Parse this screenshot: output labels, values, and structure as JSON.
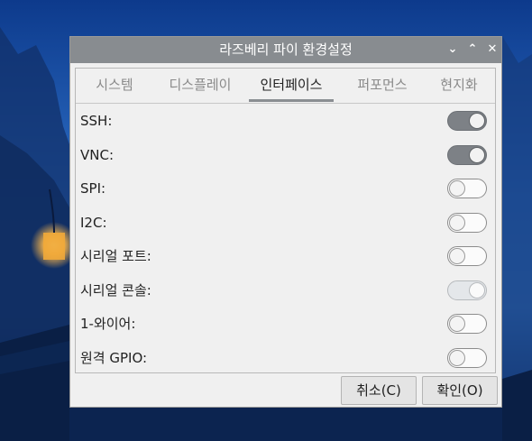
{
  "window": {
    "title": "라즈베리 파이 환경설정",
    "controls": {
      "minimize": "⌄",
      "maximize": "⌃",
      "close": "✕"
    }
  },
  "tabs": [
    {
      "label": "시스템",
      "active": false
    },
    {
      "label": "디스플레이",
      "active": false
    },
    {
      "label": "인터페이스",
      "active": true
    },
    {
      "label": "퍼포먼스",
      "active": false
    },
    {
      "label": "현지화",
      "active": false
    }
  ],
  "interfaces": [
    {
      "label": "SSH:",
      "state": "on"
    },
    {
      "label": "VNC:",
      "state": "on"
    },
    {
      "label": "SPI:",
      "state": "off"
    },
    {
      "label": "I2C:",
      "state": "off"
    },
    {
      "label": "시리얼 포트:",
      "state": "off"
    },
    {
      "label": "시리얼 콘솔:",
      "state": "disabled-on"
    },
    {
      "label": "1-와이어:",
      "state": "off"
    },
    {
      "label": "원격 GPIO:",
      "state": "off"
    }
  ],
  "buttons": {
    "cancel": "취소(C)",
    "ok": "확인(O)"
  },
  "colors": {
    "titlebar": "#888c90",
    "toggle_on": "#7d8186",
    "window_bg": "#f0f0f0"
  }
}
